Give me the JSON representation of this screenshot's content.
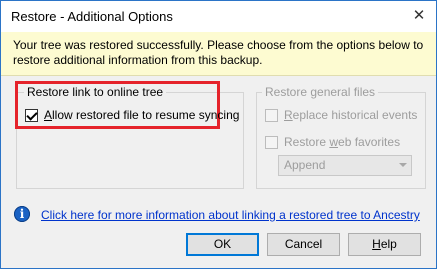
{
  "window": {
    "title": "Restore - Additional Options",
    "close_glyph": "✕"
  },
  "banner": {
    "message": "Your tree was restored successfully.  Please choose from the options below to restore additional information from this backup."
  },
  "link_group": {
    "title": "Restore link to online tree",
    "checkbox": {
      "label_underlined": "A",
      "label_rest": "llow restored file to resume syncing",
      "checked": true,
      "enabled": true
    }
  },
  "general_group": {
    "title": "Restore general files",
    "replace_events": {
      "label_before": "",
      "label_underlined": "R",
      "label_rest": "eplace historical events",
      "checked": false,
      "enabled": false
    },
    "web_favorites": {
      "label_before": "Restore ",
      "label_underlined": "w",
      "label_rest": "eb favorites",
      "checked": false,
      "enabled": false
    },
    "mode_select": {
      "value": "Append",
      "enabled": false
    }
  },
  "info": {
    "icon": "info-icon",
    "link_text": "Click here for more information about linking a restored tree to Ancestry"
  },
  "buttons": {
    "ok": "OK",
    "cancel": "Cancel",
    "help_underlined": "H",
    "help_rest": "elp"
  },
  "colors": {
    "highlight": "#e5232b",
    "banner": "#fdfbd1",
    "link": "#0033cc"
  }
}
